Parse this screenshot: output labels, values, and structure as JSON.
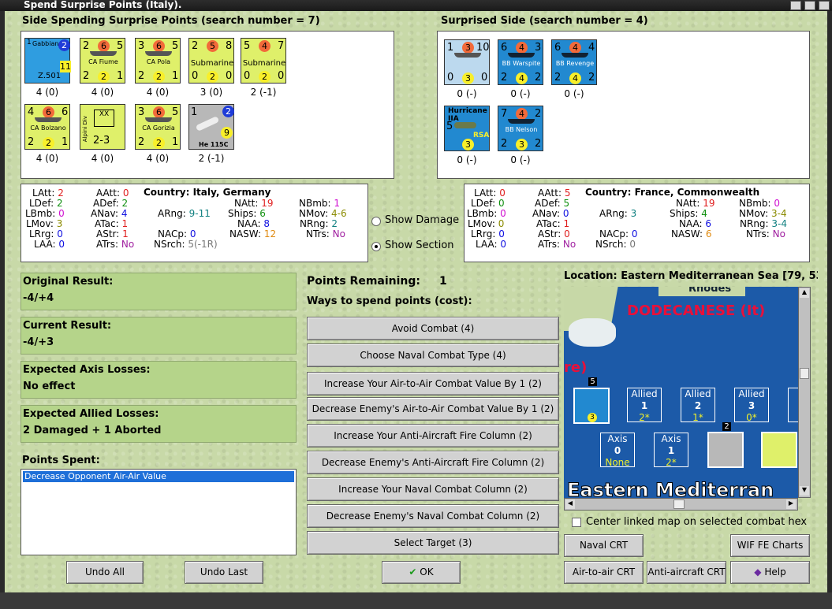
{
  "window": {
    "title": "Spend Surprise Points (Italy)."
  },
  "left_section": {
    "heading": "Side Spending Surprise Points (search number = 7)",
    "units": [
      {
        "name": "Gabbiano",
        "label": "4 (0)",
        "a": "1",
        "b": "11",
        "c": "Z.501",
        "circle": "2"
      },
      {
        "name": "CA Fiume",
        "label": "4 (0)",
        "a": "2",
        "b": "6",
        "c": "5",
        "d": "2",
        "e": "2",
        "f": "1"
      },
      {
        "name": "CA Pola",
        "label": "4 (0)",
        "a": "3",
        "b": "6",
        "c": "5",
        "d": "2",
        "e": "2",
        "f": "1"
      },
      {
        "name": "Submarine",
        "label": "3 (0)",
        "a": "2",
        "b": "5",
        "c": "8",
        "d": "0",
        "e": "2",
        "f": "0"
      },
      {
        "name": "Submarine",
        "label": "2 (-1)",
        "a": "5",
        "b": "4",
        "c": "7",
        "d": "0",
        "e": "2",
        "f": "0"
      },
      {
        "name": "CA Bolzano",
        "label": "4 (0)",
        "a": "4",
        "b": "6",
        "c": "6",
        "d": "2",
        "e": "2",
        "f": "1"
      },
      {
        "name": "Alpini Div",
        "label": "4 (0)",
        "a": "XX",
        "c": "2-3"
      },
      {
        "name": "CA Gorizia",
        "label": "4 (0)",
        "a": "3",
        "b": "6",
        "c": "5",
        "d": "2",
        "e": "2",
        "f": "1"
      },
      {
        "name": "He 115C",
        "label": "2 (-1)",
        "a": "1",
        "b": "9",
        "circle": "2"
      }
    ]
  },
  "right_section": {
    "heading": "Surprised Side (search number = 4)",
    "units": [
      {
        "name": "",
        "label": "0 (-)",
        "a": "1",
        "b": "3",
        "c": "10",
        "d": "0",
        "e": "3",
        "f": "0"
      },
      {
        "name": "BB Warspite",
        "label": "0 (-)",
        "a": "6",
        "b": "4",
        "c": "3",
        "d": "2",
        "e": "4",
        "f": "2"
      },
      {
        "name": "BB Revenge",
        "label": "0 (-)",
        "a": "6",
        "b": "4",
        "c": "4",
        "d": "2",
        "e": "4",
        "f": "2"
      },
      {
        "name": "Hurricane IIA",
        "label": "0 (-)",
        "a": "5",
        "e": "3",
        "f": "RSA"
      },
      {
        "name": "BB Nelson",
        "label": "0 (-)",
        "a": "7",
        "b": "4",
        "c": "2",
        "d": "2",
        "e": "3",
        "f": "2"
      }
    ]
  },
  "stats_left": {
    "country": "Country: Italy, Germany",
    "LAtt": "2",
    "LDef": "2",
    "LBmb": "0",
    "LMov": "3",
    "LRrg": "0",
    "LAA": "0",
    "AAtt": "0",
    "ADef": "2",
    "ANav": "4",
    "ATac": "1",
    "AStr": "1",
    "ATrs": "No",
    "ARng": "9-11",
    "NACp": "0",
    "NSrch": "5(-1R)",
    "NAtt": "19",
    "Ships": "6",
    "NAA": "8",
    "NASW": "12",
    "NBmb": "1",
    "NMov": "4-6",
    "NRng": "2",
    "NTrs": "No"
  },
  "stats_right": {
    "country": "Country: France, Commonwealth",
    "LAtt": "0",
    "LDef": "0",
    "LBmb": "0",
    "LMov": "0",
    "LRrg": "0",
    "LAA": "0",
    "AAtt": "5",
    "ADef": "5",
    "ANav": "0",
    "ATac": "1",
    "AStr": "0",
    "ATrs": "No",
    "ARng": "3",
    "NACp": "0",
    "NSrch": "0",
    "NAtt": "19",
    "Ships": "4",
    "NAA": "6",
    "NASW": "6",
    "NBmb": "0",
    "NMov": "3-4",
    "NRng": "3-4",
    "NTrs": "No"
  },
  "view_options": {
    "show_damage": "Show Damage",
    "show_section": "Show Section"
  },
  "results": {
    "original_title": "Original Result:",
    "original_value": "-4/+4",
    "current_title": "Current Result:",
    "current_value": "-4/+3",
    "axis_title": "Expected Axis Losses:",
    "axis_value": "No effect",
    "allied_title": "Expected Allied Losses:",
    "allied_value": "2 Damaged + 1 Aborted"
  },
  "points_spent": {
    "title": "Points Spent:",
    "items": [
      "Decrease Opponent Air-Air Value"
    ]
  },
  "points_remaining": {
    "label": "Points Remaining:",
    "value": "1",
    "ways": "Ways to spend points (cost):"
  },
  "spend_options": [
    "Avoid Combat (4)",
    "Choose Naval Combat Type (4)",
    "Increase Your Air-to-Air Combat Value By 1 (2)",
    "Decrease Enemy's Air-to-Air Combat Value By 1 (2)",
    "Increase Your Anti-Aircraft Fire Column (2)",
    "Decrease Enemy's Anti-Aircraft Fire Column (2)",
    "Increase Your Naval Combat Column (2)",
    "Decrease Enemy's Naval Combat Column (2)",
    "Select Target (3)"
  ],
  "map": {
    "location": "Location: Eastern Mediterranean Sea [79, 53",
    "rhodes": "Rhodes",
    "dodecanese": "DODECANESE (It)",
    "re": "re)",
    "eastern": "Eastern Mediterran",
    "stack_count": "5",
    "stack2_count": "2",
    "allied": [
      {
        "label": "Allied",
        "num": "1",
        "sub": "2*"
      },
      {
        "label": "Allied",
        "num": "2",
        "sub": "1*"
      },
      {
        "label": "Allied",
        "num": "3",
        "sub": "0*"
      }
    ],
    "axis": [
      {
        "label": "Axis",
        "num": "0",
        "sub": "None"
      },
      {
        "label": "Axis",
        "num": "1",
        "sub": "2*"
      }
    ],
    "center_linked": "Center linked map on selected combat hex"
  },
  "buttons": {
    "undo_all": "Undo All",
    "undo_last": "Undo Last",
    "ok": "OK",
    "naval_crt": "Naval CRT",
    "wif_charts": "WIF FE Charts",
    "air_crt": "Air-to-air CRT",
    "aa_crt": "Anti-aircraft CRT",
    "help": "Help"
  },
  "colors": {
    "accent_blue": "#2289d0",
    "counter_yellow": "#dff06a",
    "result_green": "#b5d48a"
  }
}
